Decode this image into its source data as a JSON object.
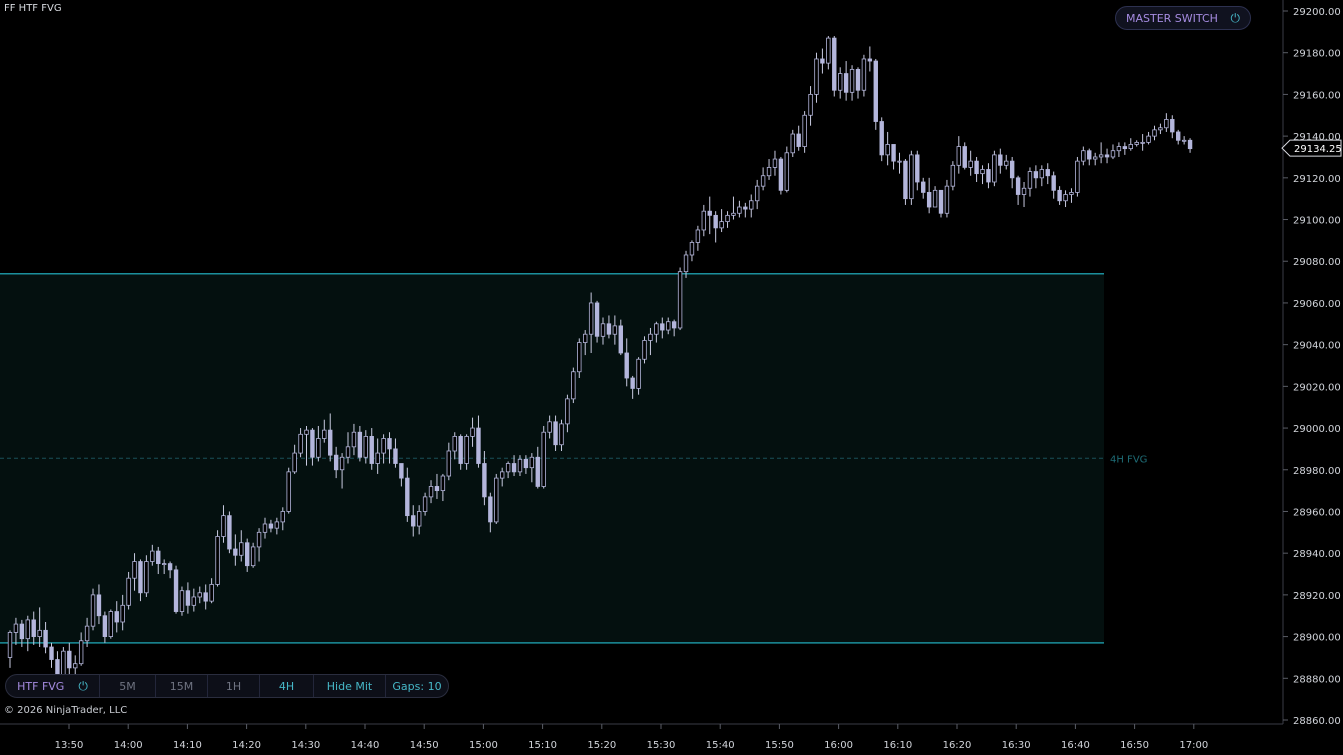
{
  "window_title": "FF HTF FVG",
  "copyright": "© 2026 NinjaTrader, LLC",
  "master_switch": {
    "label": "MASTER SWITCH",
    "icon": "power-icon"
  },
  "toolbar": {
    "title": "HTF FVG",
    "power_icon": "power-icon",
    "timeframes": [
      {
        "label": "5M",
        "active": false
      },
      {
        "label": "15M",
        "active": false
      },
      {
        "label": "1H",
        "active": false
      },
      {
        "label": "4H",
        "active": true
      }
    ],
    "hide_mit": "Hide Mit",
    "gaps": "Gaps: 10"
  },
  "colors": {
    "background": "#000000",
    "candle_body": "#b4b6dc",
    "candle_wick": "#c8cae0",
    "fvg_border": "#1b8f9c",
    "fvg_fill": "#04100f",
    "fvg_label": "#1e6c76",
    "axis_text": "#d2d5db",
    "accent_purple": "#a58be0",
    "accent_teal": "#46b7c7"
  },
  "chart_data": {
    "type": "candlestick",
    "x_ticks": [
      "13:50",
      "14:00",
      "14:10",
      "14:20",
      "14:30",
      "14:40",
      "14:50",
      "15:00",
      "15:10",
      "15:20",
      "15:30",
      "15:40",
      "15:50",
      "16:00",
      "16:10",
      "16:20",
      "16:30",
      "16:40",
      "16:50",
      "17:00"
    ],
    "y_ticks": [
      "29200.00",
      "29180.00",
      "29160.00",
      "29140.00",
      "29120.00",
      "29100.00",
      "29080.00",
      "29060.00",
      "29040.00",
      "29020.00",
      "29000.00",
      "28980.00",
      "28960.00",
      "28940.00",
      "28920.00",
      "28900.00",
      "28880.00",
      "28860.00"
    ],
    "ylim": [
      28860,
      29200
    ],
    "last_price": "29134.25",
    "fvg_zone": {
      "label": "4H FVG",
      "top": 29074,
      "bottom": 28897,
      "mid": 28985.5
    },
    "candles": [
      [
        28890,
        28902,
        28885,
        28903
      ],
      [
        28902,
        28906,
        28896,
        28909
      ],
      [
        28906,
        28899,
        28895,
        28908
      ],
      [
        28899,
        28908,
        28893,
        28910
      ],
      [
        28908,
        28900,
        28896,
        28912
      ],
      [
        28900,
        28903,
        28895,
        28914
      ],
      [
        28903,
        28895,
        28892,
        28907
      ],
      [
        28895,
        28889,
        28885,
        28897
      ],
      [
        28889,
        28881,
        28876,
        28893
      ],
      [
        28881,
        28893,
        28878,
        28895
      ],
      [
        28893,
        28885,
        28880,
        28897
      ],
      [
        28885,
        28887,
        28878,
        28891
      ],
      [
        28887,
        28898,
        28886,
        28902
      ],
      [
        28898,
        28905,
        28895,
        28909
      ],
      [
        28905,
        28920,
        28903,
        28923
      ],
      [
        28920,
        28910,
        28906,
        28925
      ],
      [
        28910,
        28900,
        28897,
        28912
      ],
      [
        28900,
        28912,
        28899,
        28913
      ],
      [
        28912,
        28907,
        28902,
        28917
      ],
      [
        28907,
        28915,
        28903,
        28920
      ],
      [
        28915,
        28928,
        28913,
        28931
      ],
      [
        28928,
        28936,
        28922,
        28940
      ],
      [
        28936,
        28921,
        28917,
        28937
      ],
      [
        28921,
        28936,
        28919,
        28939
      ],
      [
        28936,
        28941,
        28934,
        28944
      ],
      [
        28941,
        28935,
        28930,
        28943
      ],
      [
        28935,
        28935,
        28930,
        28937
      ],
      [
        28935,
        28932,
        28928,
        28936
      ],
      [
        28932,
        28912,
        28911,
        28934
      ],
      [
        28912,
        28922,
        28910,
        28924
      ],
      [
        28922,
        28915,
        28911,
        28926
      ],
      [
        28915,
        28919,
        28912,
        28923
      ],
      [
        28919,
        28921,
        28916,
        28924
      ],
      [
        28921,
        28917,
        28913,
        28925
      ],
      [
        28917,
        28925,
        28916,
        28928
      ],
      [
        28925,
        28948,
        28924,
        28951
      ],
      [
        28948,
        28958,
        28945,
        28963
      ],
      [
        28958,
        28942,
        28940,
        28960
      ],
      [
        28942,
        28939,
        28934,
        28949
      ],
      [
        28939,
        28945,
        28936,
        28951
      ],
      [
        28945,
        28934,
        28931,
        28947
      ],
      [
        28934,
        28943,
        28933,
        28945
      ],
      [
        28943,
        28950,
        28936,
        28952
      ],
      [
        28950,
        28954,
        28947,
        28957
      ],
      [
        28954,
        28952,
        28950,
        28956
      ],
      [
        28952,
        28955,
        28949,
        28957
      ],
      [
        28955,
        28960,
        28951,
        28962
      ],
      [
        28960,
        28979,
        28959,
        28981
      ],
      [
        28979,
        28988,
        28978,
        28992
      ],
      [
        28988,
        28997,
        28986,
        29000
      ],
      [
        28997,
        28999,
        28982,
        29001
      ],
      [
        28999,
        28986,
        28982,
        29000
      ],
      [
        28986,
        28995,
        28984,
        29001
      ],
      [
        28995,
        28999,
        28993,
        29004
      ],
      [
        28999,
        28987,
        28984,
        29007
      ],
      [
        28987,
        28980,
        28976,
        28991
      ],
      [
        28980,
        28986,
        28971,
        28988
      ],
      [
        28986,
        28991,
        28983,
        28998
      ],
      [
        28991,
        28998,
        28987,
        29002
      ],
      [
        28998,
        28986,
        28984,
        29001
      ],
      [
        28986,
        28996,
        28983,
        28999
      ],
      [
        28996,
        28983,
        28980,
        29000
      ],
      [
        28983,
        28988,
        28978,
        28995
      ],
      [
        28988,
        28995,
        28983,
        28997
      ],
      [
        28995,
        28990,
        28983,
        28998
      ],
      [
        28990,
        28983,
        28981,
        28995
      ],
      [
        28983,
        28976,
        28972,
        28983
      ],
      [
        28976,
        28958,
        28955,
        28981
      ],
      [
        28958,
        28953,
        28948,
        28963
      ],
      [
        28953,
        28960,
        28949,
        28963
      ],
      [
        28960,
        28967,
        28958,
        28969
      ],
      [
        28967,
        28972,
        28964,
        28975
      ],
      [
        28972,
        28970,
        28966,
        28978
      ],
      [
        28970,
        28977,
        28965,
        28978
      ],
      [
        28977,
        28989,
        28975,
        28993
      ],
      [
        28989,
        28996,
        28985,
        28998
      ],
      [
        28996,
        28983,
        28980,
        28997
      ],
      [
        28983,
        28996,
        28980,
        28997
      ],
      [
        28996,
        29000,
        28991,
        29005
      ],
      [
        29000,
        28983,
        28981,
        29006
      ],
      [
        28983,
        28967,
        28963,
        28989
      ],
      [
        28967,
        28955,
        28950,
        28969
      ],
      [
        28955,
        28976,
        28954,
        28978
      ],
      [
        28976,
        28979,
        28972,
        28981
      ],
      [
        28979,
        28983,
        28976,
        28984
      ],
      [
        28983,
        28979,
        28977,
        28987
      ],
      [
        28979,
        28985,
        28977,
        28987
      ],
      [
        28985,
        28981,
        28978,
        28987
      ],
      [
        28981,
        28986,
        28974,
        28988
      ],
      [
        28986,
        28972,
        28971,
        28991
      ],
      [
        28972,
        28998,
        28971,
        29001
      ],
      [
        28998,
        29003,
        28995,
        29006
      ],
      [
        29003,
        28992,
        28989,
        29006
      ],
      [
        28992,
        29002,
        28989,
        29004
      ],
      [
        29002,
        29014,
        28998,
        29016
      ],
      [
        29014,
        29027,
        29012,
        29029
      ],
      [
        29027,
        29041,
        29024,
        29043
      ],
      [
        29041,
        29045,
        29035,
        29047
      ],
      [
        29045,
        29060,
        29036,
        29065
      ],
      [
        29060,
        29044,
        29041,
        29061
      ],
      [
        29044,
        29050,
        29040,
        29053
      ],
      [
        29050,
        29045,
        29043,
        29054
      ],
      [
        29045,
        29049,
        29040,
        29054
      ],
      [
        29049,
        29036,
        29035,
        29052
      ],
      [
        29036,
        29024,
        29020,
        29043
      ],
      [
        29024,
        29019,
        29014,
        29025
      ],
      [
        29019,
        29033,
        29016,
        29034
      ],
      [
        29033,
        29042,
        29031,
        29044
      ],
      [
        29042,
        29045,
        29035,
        29048
      ],
      [
        29045,
        29050,
        29041,
        29051
      ],
      [
        29050,
        29047,
        29043,
        29053
      ],
      [
        29047,
        29051,
        29045,
        29053
      ],
      [
        29051,
        29048,
        29044,
        29052
      ],
      [
        29048,
        29075,
        29047,
        29077
      ],
      [
        29075,
        29083,
        29072,
        29085
      ],
      [
        29083,
        29089,
        29080,
        29090
      ],
      [
        29089,
        29095,
        29085,
        29097
      ],
      [
        29095,
        29104,
        29092,
        29107
      ],
      [
        29104,
        29102,
        29093,
        29111
      ],
      [
        29102,
        29096,
        29089,
        29104
      ],
      [
        29096,
        29099,
        29094,
        29105
      ],
      [
        29099,
        29102,
        29096,
        29104
      ],
      [
        29102,
        29103,
        29100,
        29111
      ],
      [
        29103,
        29106,
        29101,
        29109
      ],
      [
        29106,
        29105,
        29101,
        29108
      ],
      [
        29105,
        29109,
        29101,
        29112
      ],
      [
        29109,
        29116,
        29105,
        29119
      ],
      [
        29116,
        29121,
        29114,
        29125
      ],
      [
        29121,
        29125,
        29119,
        29129
      ],
      [
        29125,
        29129,
        29121,
        29133
      ],
      [
        29129,
        29114,
        29112,
        29130
      ],
      [
        29114,
        29132,
        29113,
        29135
      ],
      [
        29132,
        29141,
        29130,
        29143
      ],
      [
        29141,
        29135,
        29133,
        29145
      ],
      [
        29135,
        29150,
        29132,
        29152
      ],
      [
        29150,
        29160,
        29145,
        29164
      ],
      [
        29160,
        29177,
        29156,
        29180
      ],
      [
        29177,
        29175,
        29170,
        29182
      ],
      [
        29175,
        29187,
        29172,
        29188
      ],
      [
        29187,
        29162,
        29159,
        29188
      ],
      [
        29162,
        29170,
        29158,
        29173
      ],
      [
        29170,
        29161,
        29157,
        29176
      ],
      [
        29161,
        29172,
        29157,
        29174
      ],
      [
        29172,
        29162,
        29158,
        29173
      ],
      [
        29162,
        29177,
        29159,
        29179
      ],
      [
        29177,
        29176,
        29171,
        29183
      ],
      [
        29176,
        29147,
        29143,
        29177
      ],
      [
        29147,
        29131,
        29128,
        29149
      ],
      [
        29131,
        29136,
        29126,
        29142
      ],
      [
        29136,
        29128,
        29124,
        29136
      ],
      [
        29128,
        29128,
        29122,
        29132
      ],
      [
        29128,
        29110,
        29107,
        29129
      ],
      [
        29110,
        29131,
        29107,
        29133
      ],
      [
        29131,
        29118,
        29114,
        29133
      ],
      [
        29118,
        29113,
        29110,
        29120
      ],
      [
        29113,
        29106,
        29103,
        29120
      ],
      [
        29106,
        29114,
        29109,
        29116
      ],
      [
        29114,
        29103,
        29101,
        29110
      ],
      [
        29103,
        29116,
        29101,
        29119
      ],
      [
        29116,
        29126,
        29114,
        29128
      ],
      [
        29126,
        29135,
        29122,
        29140
      ],
      [
        29135,
        29125,
        29124,
        29137
      ],
      [
        29125,
        29128,
        29121,
        29133
      ],
      [
        29128,
        29122,
        29118,
        29130
      ],
      [
        29122,
        29124,
        29117,
        29126
      ],
      [
        29124,
        29118,
        29115,
        29127
      ],
      [
        29118,
        29131,
        29116,
        29133
      ],
      [
        29131,
        29126,
        29122,
        29134
      ],
      [
        29126,
        29128,
        29124,
        29131
      ],
      [
        29128,
        29120,
        29115,
        29130
      ],
      [
        29120,
        29112,
        29107,
        29121
      ],
      [
        29112,
        29115,
        29106,
        29118
      ],
      [
        29115,
        29123,
        29111,
        29125
      ],
      [
        29123,
        29120,
        29115,
        29126
      ],
      [
        29120,
        29124,
        29116,
        29126
      ],
      [
        29124,
        29121,
        29117,
        29127
      ],
      [
        29121,
        29114,
        29110,
        29123
      ],
      [
        29114,
        29109,
        29107,
        29116
      ],
      [
        29109,
        29112,
        29106,
        29114
      ],
      [
        29112,
        29113,
        29108,
        29115
      ],
      [
        29113,
        29128,
        29111,
        29130
      ],
      [
        29128,
        29133,
        29126,
        29135
      ],
      [
        29133,
        29129,
        29126,
        29134
      ],
      [
        29129,
        29130,
        29126,
        29132
      ],
      [
        29130,
        29131,
        29127,
        29137
      ],
      [
        29131,
        29130,
        29127,
        29134
      ],
      [
        29130,
        29133,
        29129,
        29136
      ],
      [
        29133,
        29135,
        29130,
        29137
      ],
      [
        29135,
        29134,
        29131,
        29137
      ],
      [
        29134,
        29136,
        29133,
        29139
      ],
      [
        29136,
        29137,
        29135,
        29138
      ],
      [
        29137,
        29137,
        29133,
        29141
      ],
      [
        29137,
        29140,
        29136,
        29142
      ],
      [
        29140,
        29143,
        29138,
        29145
      ],
      [
        29143,
        29144,
        29141,
        29146
      ],
      [
        29144,
        29148,
        29142,
        29151
      ],
      [
        29148,
        29142,
        29139,
        29150
      ],
      [
        29142,
        29138,
        29136,
        29143
      ],
      [
        29138,
        29138,
        29136,
        29140
      ],
      [
        29138,
        29134,
        29132,
        29139
      ]
    ]
  }
}
